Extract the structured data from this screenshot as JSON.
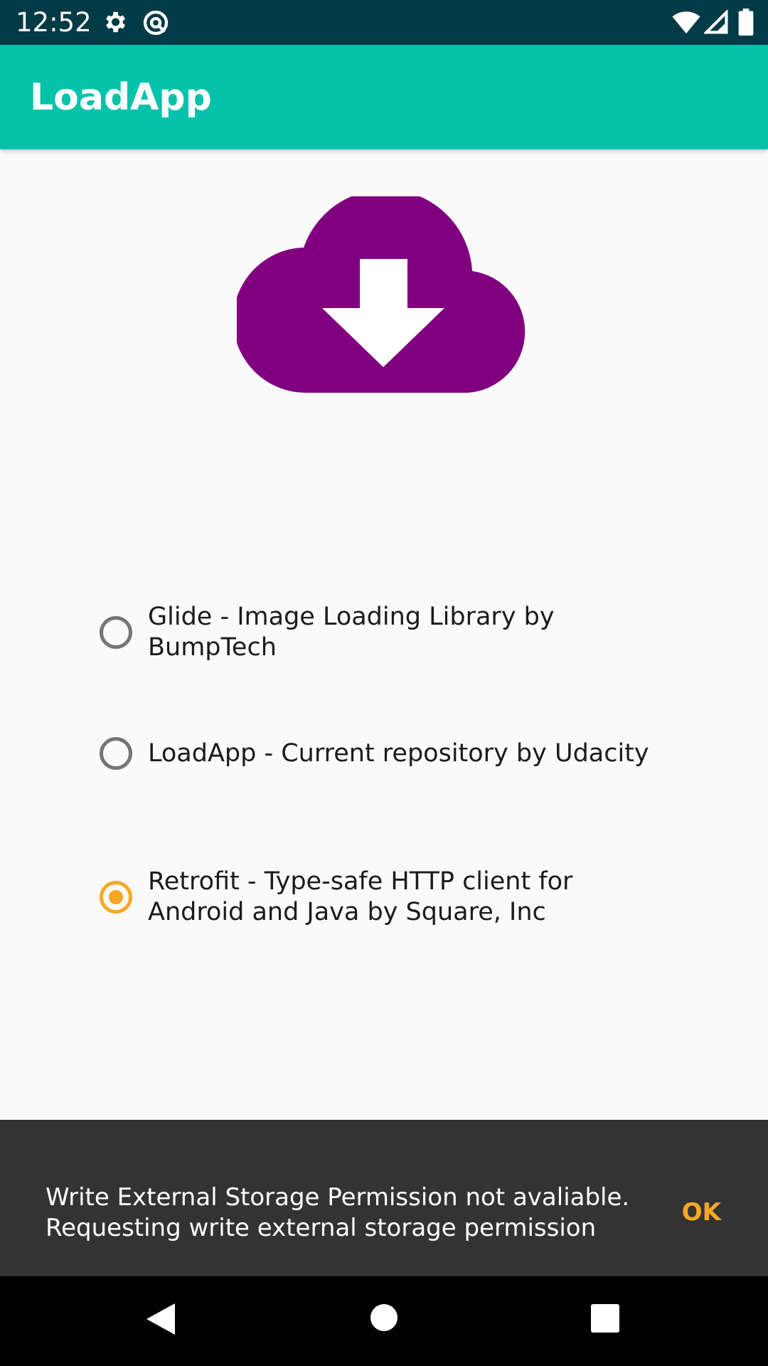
{
  "status_bar": {
    "time": "12:52",
    "icons": [
      "settings-icon",
      "at-sign-icon",
      "wifi-icon",
      "cellular-signal-icon",
      "battery-icon"
    ]
  },
  "app_bar": {
    "title": "LoadApp"
  },
  "hero": {
    "icon": "cloud-download-icon",
    "color": "#800080"
  },
  "radio_group": {
    "options": [
      {
        "label": "Glide - Image Loading Library by BumpTech",
        "checked": false
      },
      {
        "label": "LoadApp - Current repository by Udacity",
        "checked": false
      },
      {
        "label": "Retrofit - Type-safe HTTP client for Android and Java by Square, Inc",
        "checked": true
      }
    ],
    "accent_color": "#f7a823"
  },
  "snackbar": {
    "message_line1": "Write External Storage Permission not avaliable.",
    "message_line2": "Requesting write external storage permission",
    "action": "OK"
  },
  "nav_bar": {
    "icons": [
      "back-icon",
      "home-icon",
      "recents-icon"
    ]
  },
  "colors": {
    "status_bar": "#023a45",
    "app_bar": "#07c2ab",
    "background": "#fafafa",
    "snackbar": "#333333"
  }
}
